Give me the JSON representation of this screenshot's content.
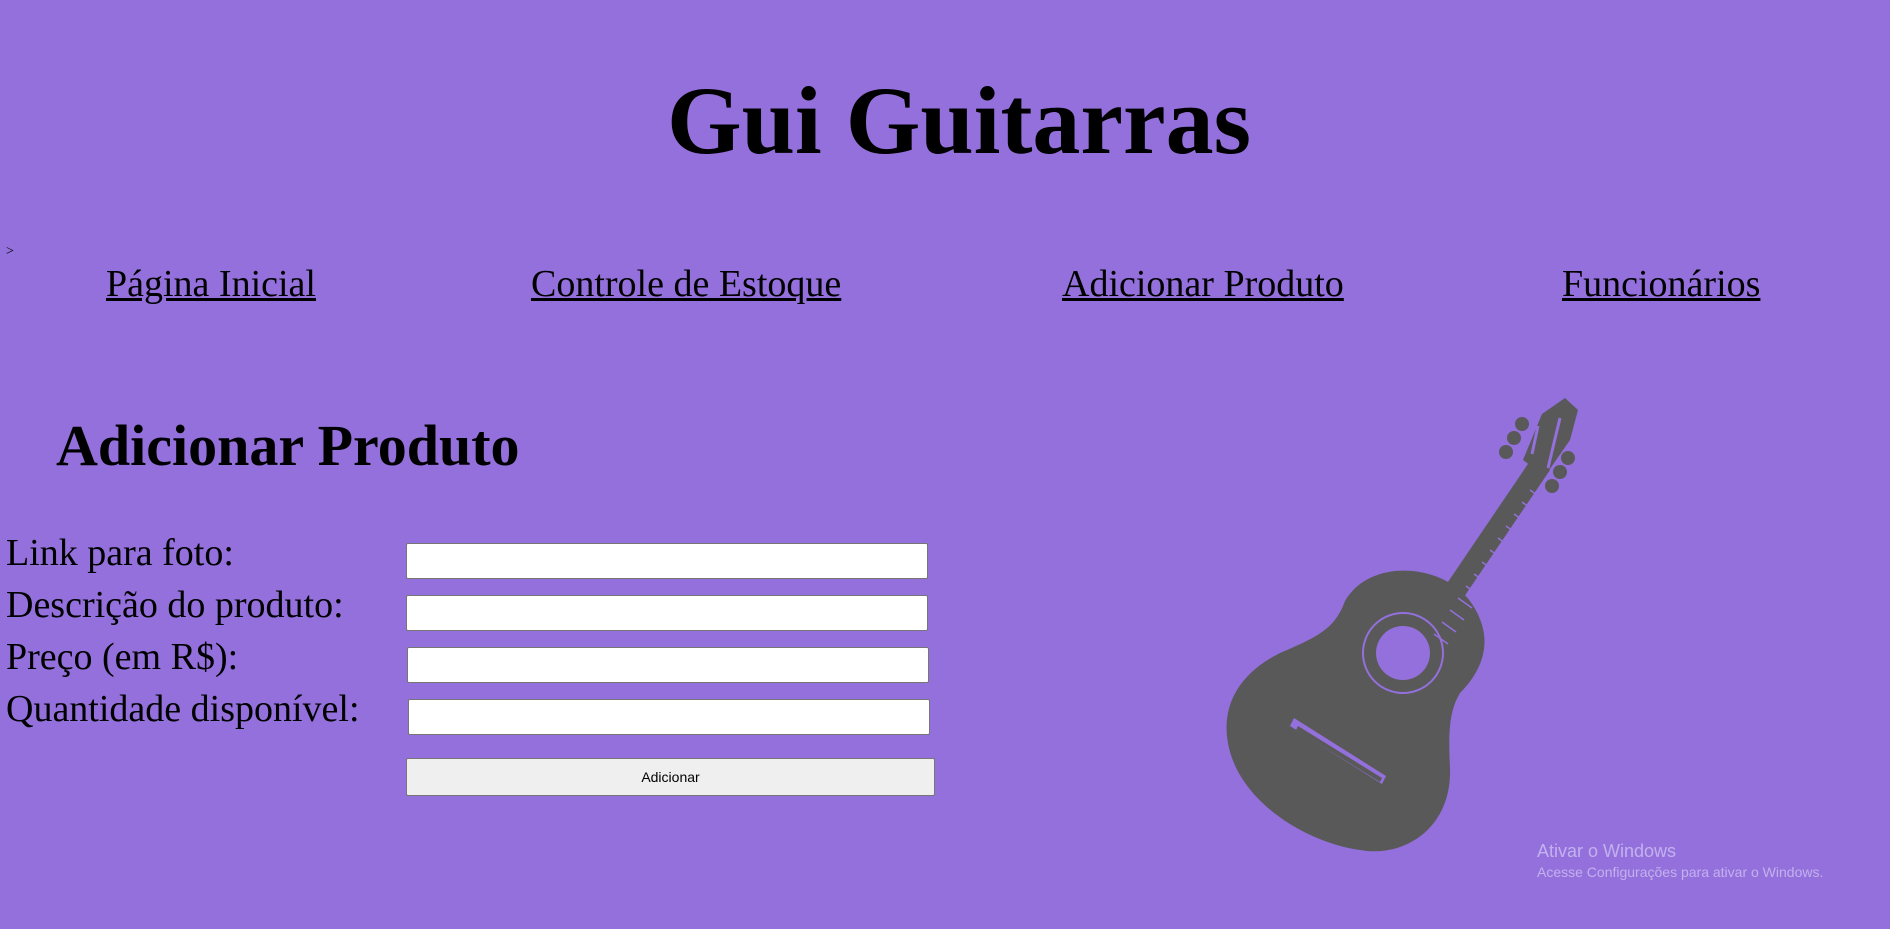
{
  "site": {
    "title": "Gui Guitarras",
    "stray_text": ">"
  },
  "nav": {
    "items": [
      {
        "label": "Página Inicial"
      },
      {
        "label": "Controle de Estoque"
      },
      {
        "label": "Adicionar Produto"
      },
      {
        "label": "Funcionários"
      }
    ]
  },
  "page": {
    "heading": "Adicionar Produto"
  },
  "form": {
    "fields": [
      {
        "label": "Link para foto:",
        "value": ""
      },
      {
        "label": "Descrição do produto:",
        "value": ""
      },
      {
        "label": "Preço (em R$):",
        "value": ""
      },
      {
        "label": "Quantidade disponível:",
        "value": ""
      }
    ],
    "submit_label": "Adicionar"
  },
  "illustration": {
    "icon": "guitar-icon",
    "color": "#595959"
  },
  "watermark": {
    "title": "Ativar o Windows",
    "subtitle": "Acesse Configurações para ativar o Windows."
  },
  "colors": {
    "background": "#9370db"
  }
}
